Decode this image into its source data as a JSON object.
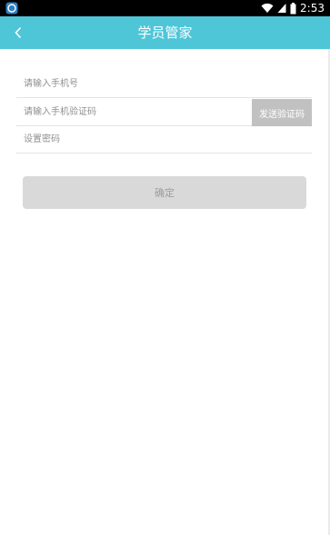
{
  "status_bar": {
    "time": "2:53",
    "icons": [
      "app-notification-icon",
      "wifi-icon",
      "signal-icon",
      "battery-icon"
    ]
  },
  "app_bar": {
    "title": "学员管家",
    "back_icon": "chevron-left-icon",
    "background": "#4ec6d8"
  },
  "form": {
    "phone": {
      "placeholder": "请输入手机号",
      "value": ""
    },
    "code": {
      "placeholder": "请输入手机验证码",
      "value": ""
    },
    "send_code_label": "发送验证码",
    "password": {
      "placeholder": "设置密码",
      "value": ""
    },
    "confirm_label": "确定"
  }
}
